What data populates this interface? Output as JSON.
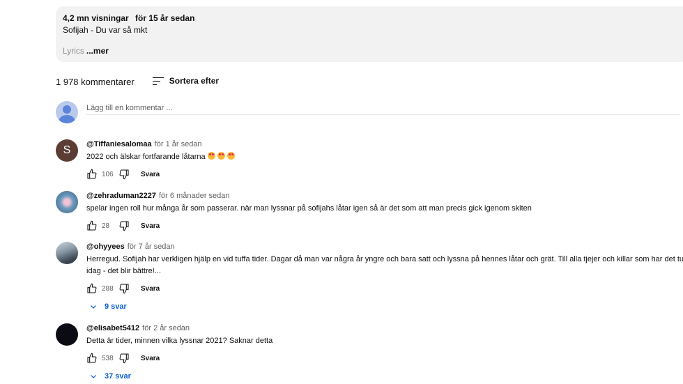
{
  "description": {
    "views": "4,2 mn visningar",
    "age": "för 15 år sedan",
    "title_line": "Sofijah - Du var så mkt",
    "lyrics_fade": "Lyrics",
    "more_label": "...mer"
  },
  "comments_header": {
    "count": "1 978 kommentarer",
    "sort_label": "Sortera efter"
  },
  "add_comment": {
    "placeholder": "Lägg till en kommentar ..."
  },
  "comments": [
    {
      "author": "@Tiffaniesalomaa",
      "time": "för 1 år sedan",
      "text": "2022 och älskar fortfarande låtarna",
      "avatar_letter": "S",
      "likes": "106",
      "reply_label": "Svara"
    },
    {
      "author": "@zehraduman2227",
      "time": "för 6 månader sedan",
      "text": "spelar ingen roll hur många år som passerar. när man lyssnar på sofijahs låtar igen så är det som att man precis gick igenom skiten",
      "likes": "28",
      "reply_label": "Svara"
    },
    {
      "author": "@ohyyees",
      "time": "för 7 år sedan",
      "text_line1": "Herregud. Sofijah har verkligen hjälp en vid tuffa tider. Dagar då man var några år yngre och bara satt och lyssna på hennes låtar och grät. Till alla tjejer och killar som har det tufft",
      "text_line2": "idag - det blir bättre!...",
      "likes": "288",
      "reply_label": "Svara",
      "replies_label": "9 svar"
    },
    {
      "author": "@elisabet5412",
      "time": "för 2 år sedan",
      "text": "Detta är tider, minnen vilka lyssnar 2021? Saknar detta",
      "likes": "538",
      "reply_label": "Svara",
      "replies_label": "37 svar"
    }
  ],
  "icons": {
    "like": "thumbs-up-icon",
    "dislike": "thumbs-down-icon",
    "sort": "sort-icon",
    "expand": "chevron-down-icon",
    "emoji": "heart-eyes-emoji-icon"
  },
  "colors": {
    "link_blue": "#065fd4",
    "desc_bg": "#f2f2f2",
    "secondary_text": "#606060"
  }
}
